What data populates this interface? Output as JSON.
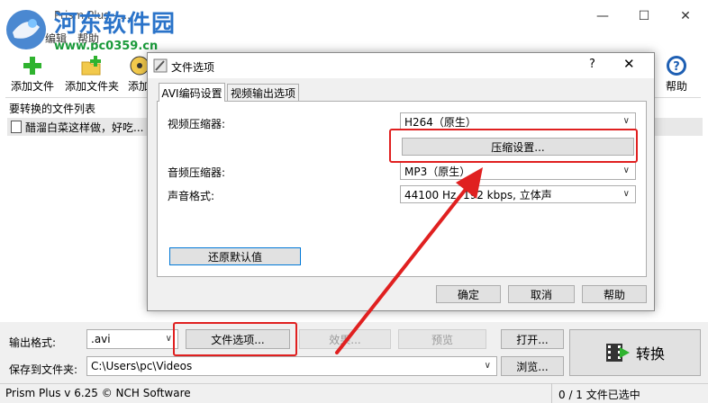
{
  "window": {
    "app_title": "Prism Plus - ...",
    "controls": {
      "minimize": "—",
      "maximize": "☐",
      "close": "✕"
    }
  },
  "watermark": {
    "text": "河东软件园",
    "url": "www.pc0359.cn"
  },
  "menu": {
    "items": [
      "编辑",
      "帮助"
    ]
  },
  "toolbar": {
    "add_file": "添加文件",
    "add_folder": "添加文件夹",
    "add_partial": "添加",
    "help": "帮助"
  },
  "list": {
    "header": "要转换的文件列表",
    "rows": [
      "醋溜白菜这样做，好吃..."
    ]
  },
  "bottom": {
    "output_format_label": "输出格式:",
    "output_format_value": ".avi",
    "file_options_button": "文件选项...",
    "effects_button": "效果...",
    "preview_button": "预览",
    "open_button": "打开...",
    "save_folder_label": "保存到文件夹:",
    "save_folder_value": "C:\\Users\\pc\\Videos",
    "browse_button": "浏览...",
    "convert_button": "转换"
  },
  "status": {
    "left": "Prism Plus v 6.25 © NCH Software",
    "right": "0 / 1 文件已选中"
  },
  "dialog": {
    "title": "文件选项",
    "help": "?",
    "close": "✕",
    "tabs": [
      "AVI编码设置",
      "视频输出选项"
    ],
    "video_compressor_label": "视频压缩器:",
    "video_compressor_value": "H264（原生）",
    "compress_settings_button": "压缩设置...",
    "audio_compressor_label": "音频压缩器:",
    "audio_compressor_value": "MP3（原生）",
    "audio_format_label": "声音格式:",
    "audio_format_value": "44100 Hz, 192 kbps, 立体声",
    "restore_defaults_button": "还原默认值",
    "ok_button": "确定",
    "cancel_button": "取消",
    "help_button": "帮助"
  },
  "colors": {
    "annotation_red": "#e02020",
    "watermark_blue": "#2a73c9",
    "watermark_green": "#1a9a3a",
    "selection_blue": "#0078d7"
  }
}
